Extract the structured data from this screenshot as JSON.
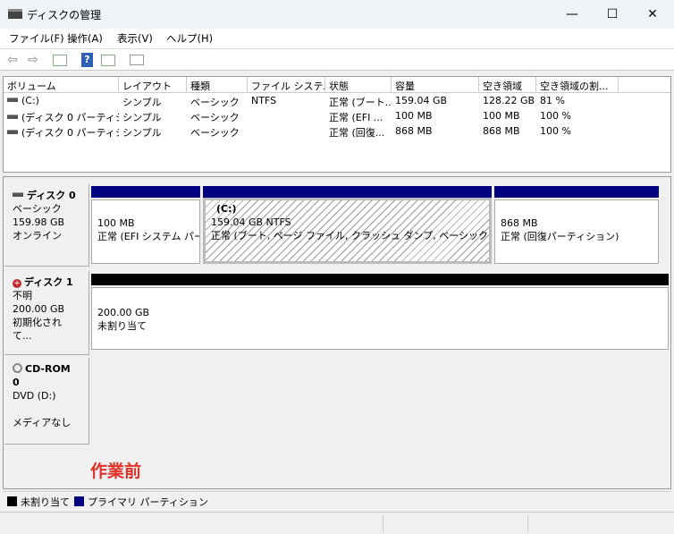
{
  "window": {
    "title": "ディスクの管理",
    "minimize": "—",
    "maximize": "☐",
    "close": "✕"
  },
  "menu": [
    "ファイル(F)",
    "操作(A)",
    "表示(V)",
    "ヘルプ(H)"
  ],
  "toolbar": {
    "icons": [
      "back-arrow",
      "forward-arrow",
      "show-hide-console-tree",
      "help",
      "show-action-pane",
      "properties"
    ]
  },
  "volume_list": {
    "columns": [
      "ボリューム",
      "レイアウト",
      "種類",
      "ファイル システム",
      "状態",
      "容量",
      "空き領域",
      "空き領域の割..."
    ],
    "rows": [
      [
        "(C:)",
        "シンプル",
        "ベーシック",
        "NTFS",
        "正常 (ブート...",
        "159.04 GB",
        "128.22 GB",
        "81 %"
      ],
      [
        "(ディスク 0 パーティシ...",
        "シンプル",
        "ベーシック",
        "",
        "正常 (EFI ...",
        "100 MB",
        "100 MB",
        "100 %"
      ],
      [
        "(ディスク 0 パーティシ...",
        "シンプル",
        "ベーシック",
        "",
        "正常 (回復...",
        "868 MB",
        "868 MB",
        "100 %"
      ]
    ]
  },
  "disks": [
    {
      "name": "ディスク 0",
      "type": "ベーシック",
      "size": "159.98 GB",
      "status": "オンライン",
      "partitions": [
        {
          "name": "",
          "size": "100 MB",
          "status": "正常 (EFI システム パーティション)"
        },
        {
          "name": "(C:)",
          "size": "159.04 GB NTFS",
          "status": "正常 (ブート, ページ ファイル, クラッシュ ダンプ, ベーシック データ パーティション)"
        },
        {
          "name": "",
          "size": "868 MB",
          "status": "正常 (回復パーティション)"
        }
      ]
    },
    {
      "name": "ディスク 1",
      "type": "不明",
      "size": "200.00 GB",
      "status": "初期化されて...",
      "partitions": [
        {
          "size": "200.00 GB",
          "status": "未割り当て"
        }
      ]
    },
    {
      "name": "CD-ROM 0",
      "type": "DVD (D:)",
      "status": "メディアなし"
    }
  ],
  "annotation": "作業前",
  "legend": [
    {
      "label": "未割り当て",
      "color": "#000000"
    },
    {
      "label": "プライマリ パーティション",
      "color": "#000080"
    }
  ],
  "colors": {
    "primary": "#000080",
    "unallocated": "#000000",
    "annotation": "#e0312b"
  }
}
